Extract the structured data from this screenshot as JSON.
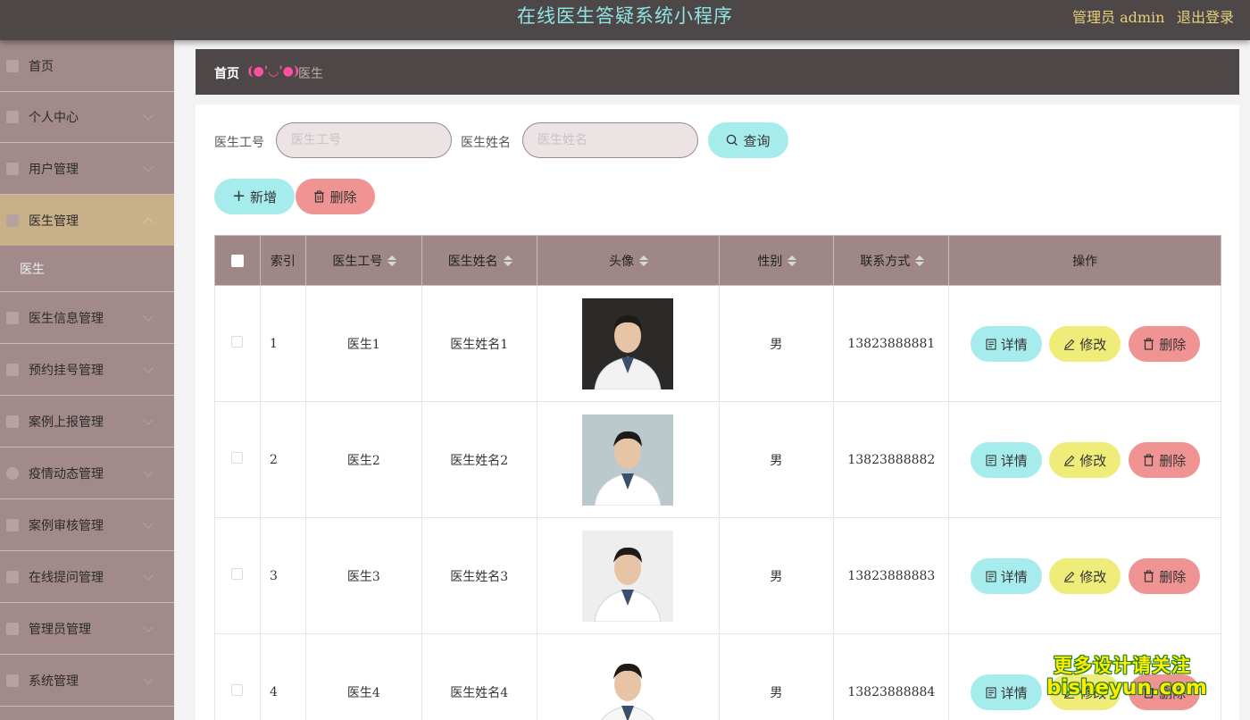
{
  "header": {
    "app_title": "在线医生答疑系统小程序",
    "user_label": "管理员 admin",
    "logout_label": "退出登录"
  },
  "sidebar": {
    "items": [
      {
        "label": "首页",
        "icon": "home-icon",
        "expandable": false
      },
      {
        "label": "个人中心",
        "icon": "user-icon",
        "expandable": true
      },
      {
        "label": "用户管理",
        "icon": "users-icon",
        "expandable": true
      },
      {
        "label": "医生管理",
        "icon": "doctor-icon",
        "expandable": true,
        "active": true
      },
      {
        "label": "医生信息管理",
        "icon": "info-icon",
        "expandable": true
      },
      {
        "label": "预约挂号管理",
        "icon": "briefcase-icon",
        "expandable": true
      },
      {
        "label": "案例上报管理",
        "icon": "report-icon",
        "expandable": true
      },
      {
        "label": "疫情动态管理",
        "icon": "globe-icon",
        "expandable": true
      },
      {
        "label": "案例审核管理",
        "icon": "audit-icon",
        "expandable": true
      },
      {
        "label": "在线提问管理",
        "icon": "question-icon",
        "expandable": true
      },
      {
        "label": "管理员管理",
        "icon": "admin-icon",
        "expandable": true
      },
      {
        "label": "系统管理",
        "icon": "flag-icon",
        "expandable": true
      }
    ],
    "sub_item": "医生"
  },
  "breadcrumb": {
    "home": "首页",
    "separator": "(●'◡'●)",
    "current": "医生"
  },
  "search": {
    "id_label": "医生工号",
    "id_placeholder": "医生工号",
    "id_value": "",
    "name_label": "医生姓名",
    "name_placeholder": "医生姓名",
    "name_value": "",
    "query_label": "查询"
  },
  "actions": {
    "add_label": "新增",
    "delete_label": "删除"
  },
  "table": {
    "columns": [
      "索引",
      "医生工号",
      "医生姓名",
      "头像",
      "性别",
      "联系方式",
      "操作"
    ],
    "row_actions": {
      "detail": "详情",
      "edit": "修改",
      "delete": "删除"
    },
    "rows": [
      {
        "index": "1",
        "id": "医生1",
        "name": "医生姓名1",
        "gender": "男",
        "phone": "13823888881"
      },
      {
        "index": "2",
        "id": "医生2",
        "name": "医生姓名2",
        "gender": "男",
        "phone": "13823888882"
      },
      {
        "index": "3",
        "id": "医生3",
        "name": "医生姓名3",
        "gender": "男",
        "phone": "13823888883"
      },
      {
        "index": "4",
        "id": "医生4",
        "name": "医生姓名4",
        "gender": "男",
        "phone": "13823888884"
      }
    ]
  },
  "watermark": {
    "line1": "更多设计请关注",
    "line2": "bisheyun.com"
  },
  "colors": {
    "topbar": "#4e4747",
    "sidebar": "#a28a8a",
    "active_menu": "#c8b089",
    "cyan_button": "#a7ecec",
    "red_button": "#ef9393",
    "yellow_button": "#f0ec7a",
    "table_header": "#a08787"
  }
}
